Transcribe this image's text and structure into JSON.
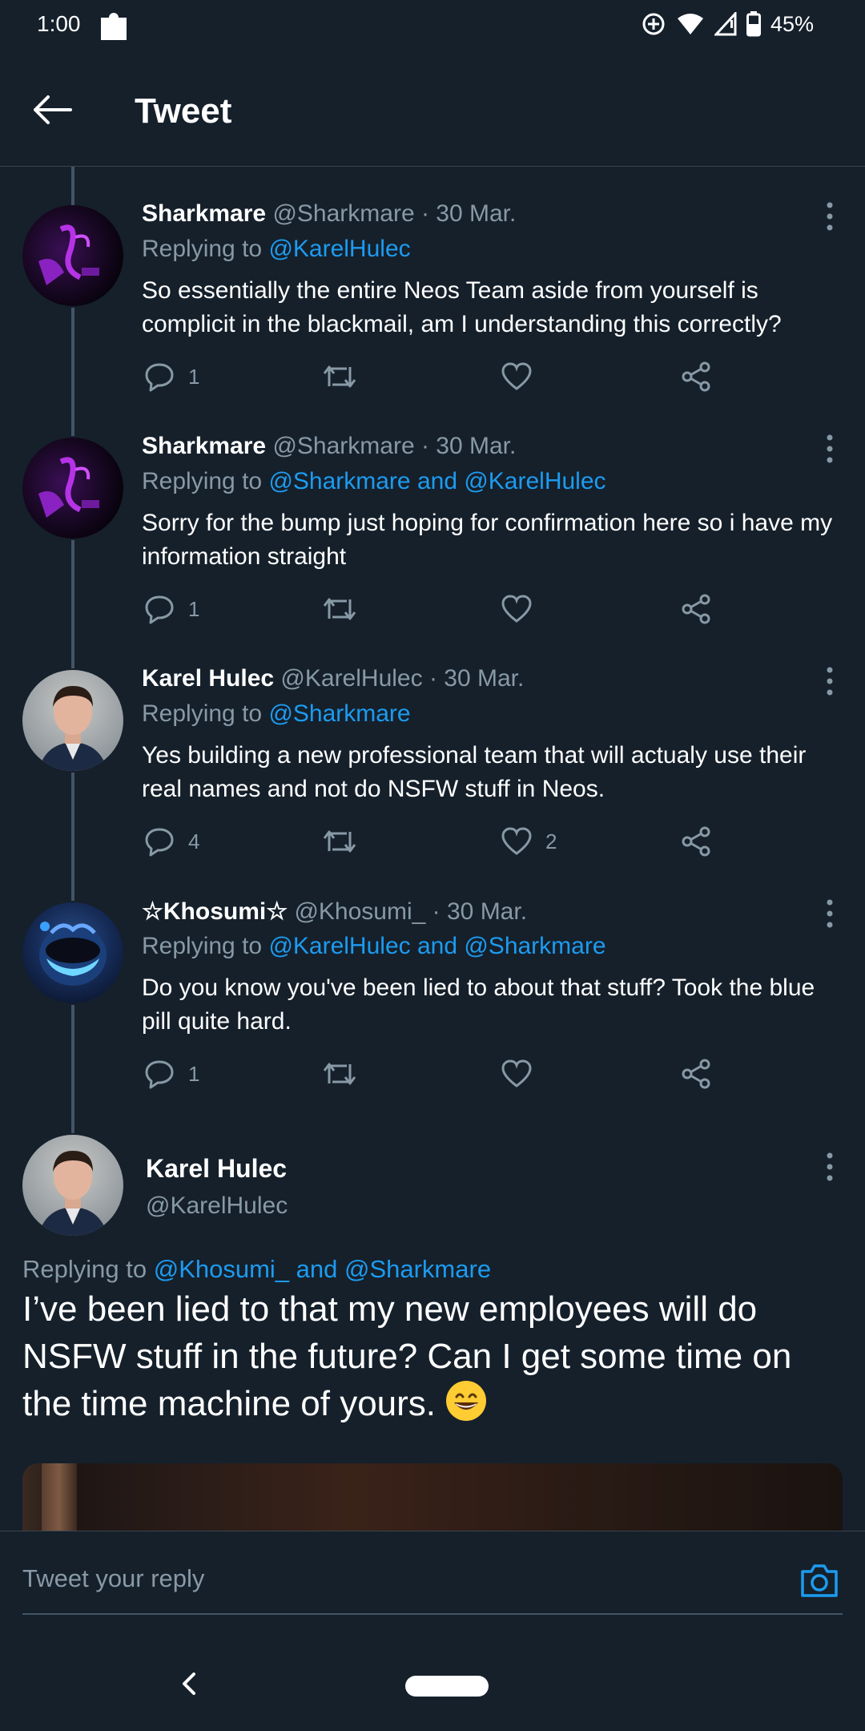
{
  "status_bar": {
    "time": "1:00",
    "battery": "45%"
  },
  "app_bar": {
    "title": "Tweet"
  },
  "colors": {
    "background": "#15202b",
    "link": "#1d9bf0",
    "muted": "#8899a6",
    "divider": "#38444d"
  },
  "tweets": [
    {
      "name": "Sharkmare",
      "meta": "@Sharkmare · 30 Mar.",
      "replying_prefix": "Replying to",
      "replying_to": "@KarelHulec",
      "body": "So essentially the entire Neos Team aside from yourself is complicit in the blackmail, am I understanding this correctly?",
      "replies": "1",
      "retweets": "",
      "likes": "",
      "avatar_icon": "sharkmare-avatar"
    },
    {
      "name": "Sharkmare",
      "meta": "@Sharkmare · 30 Mar.",
      "replying_prefix": "Replying to",
      "replying_to": "@Sharkmare and @KarelHulec",
      "body": "Sorry for the bump just hoping for confirmation here so i have my information straight",
      "replies": "1",
      "retweets": "",
      "likes": "",
      "avatar_icon": "sharkmare-avatar"
    },
    {
      "name": "Karel Hulec",
      "meta": "@KarelHulec · 30 Mar.",
      "replying_prefix": "Replying to",
      "replying_to": "@Sharkmare",
      "body": "Yes building a new professional team that will actualy use their real names and not do NSFW stuff in Neos.",
      "replies": "4",
      "retweets": "",
      "likes": "2",
      "avatar_icon": "karel-avatar"
    },
    {
      "name": "☆Khosumi☆",
      "meta": "@Khosumi_ · 30 Mar.",
      "replying_prefix": "Replying to",
      "replying_to": "@KarelHulec and @Sharkmare",
      "body": "Do you know you've been lied to about that stuff? Took the blue pill quite hard.",
      "replies": "1",
      "retweets": "",
      "likes": "",
      "avatar_icon": "khosumi-avatar"
    }
  ],
  "main_tweet": {
    "name": "Karel Hulec",
    "handle": "@KarelHulec",
    "replying_prefix": "Replying to",
    "replying_to": "@Khosumi_ and @Sharkmare",
    "body": "I’ve been lied to that my new employees will do NSFW stuff in the future? Can I get some time on the time machine of yours.",
    "emoji": "grinning-face-emoji"
  },
  "reply_bar": {
    "placeholder": "Tweet your reply"
  }
}
